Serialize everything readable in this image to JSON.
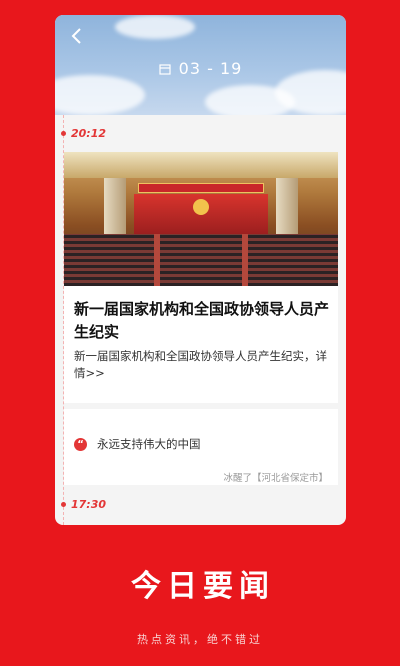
{
  "header": {
    "date": "03 - 19",
    "icons": {
      "back": "chevron-left-icon",
      "calendar": "calendar-icon"
    }
  },
  "timeline": {
    "entries": [
      {
        "time": "20:12"
      },
      {
        "time": "17:30"
      }
    ]
  },
  "article": {
    "title": "新一届国家机构和全国政协领导人员产生纪实",
    "summary": "新一届国家机构和全国政协领导人员产生纪实，详情>>",
    "comment": {
      "text": "永远支持伟大的中国",
      "author": "冰醒了【河北省保定市】",
      "icon": "quote-icon",
      "icon_glyph": "“"
    }
  },
  "brand": {
    "chars": [
      "今",
      "日",
      "要",
      "闻"
    ],
    "tagline": "热点资讯，绝不错过"
  },
  "colors": {
    "background": "#e8171c",
    "accent": "#e33636",
    "card": "#ffffff"
  }
}
